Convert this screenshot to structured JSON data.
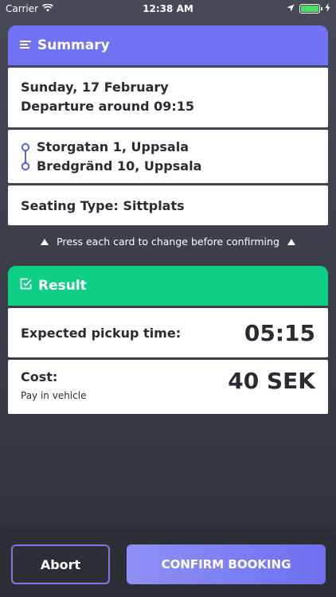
{
  "status_bar": {
    "carrier": "Carrier",
    "time": "12:38 AM",
    "battery_level": 1.0
  },
  "summary": {
    "title": "Summary",
    "date": "Sunday, 17 February",
    "departure": "Departure around 09:15",
    "from": "Storgatan 1, Uppsala",
    "to": "Bredgränd 10, Uppsala",
    "seating": "Seating Type: Sittplats"
  },
  "hint": "Press each card to change before confirming",
  "result": {
    "title": "Result",
    "pickup_label": "Expected pickup time:",
    "pickup_time": "05:15",
    "cost_label": "Cost:",
    "cost_note": "Pay in vehicle",
    "cost_value": "40 SEK"
  },
  "actions": {
    "abort": "Abort",
    "confirm": "CONFIRM BOOKING"
  },
  "colors": {
    "summary_header": "#6f72f2",
    "result_header": "#0ecf86",
    "confirm_button": "#7b7cf2",
    "abort_border": "#7b78e8"
  },
  "icons": {
    "summary": "list-icon",
    "result": "check-square-icon",
    "route": "route-icon",
    "hint": "triangle-up-icon"
  }
}
